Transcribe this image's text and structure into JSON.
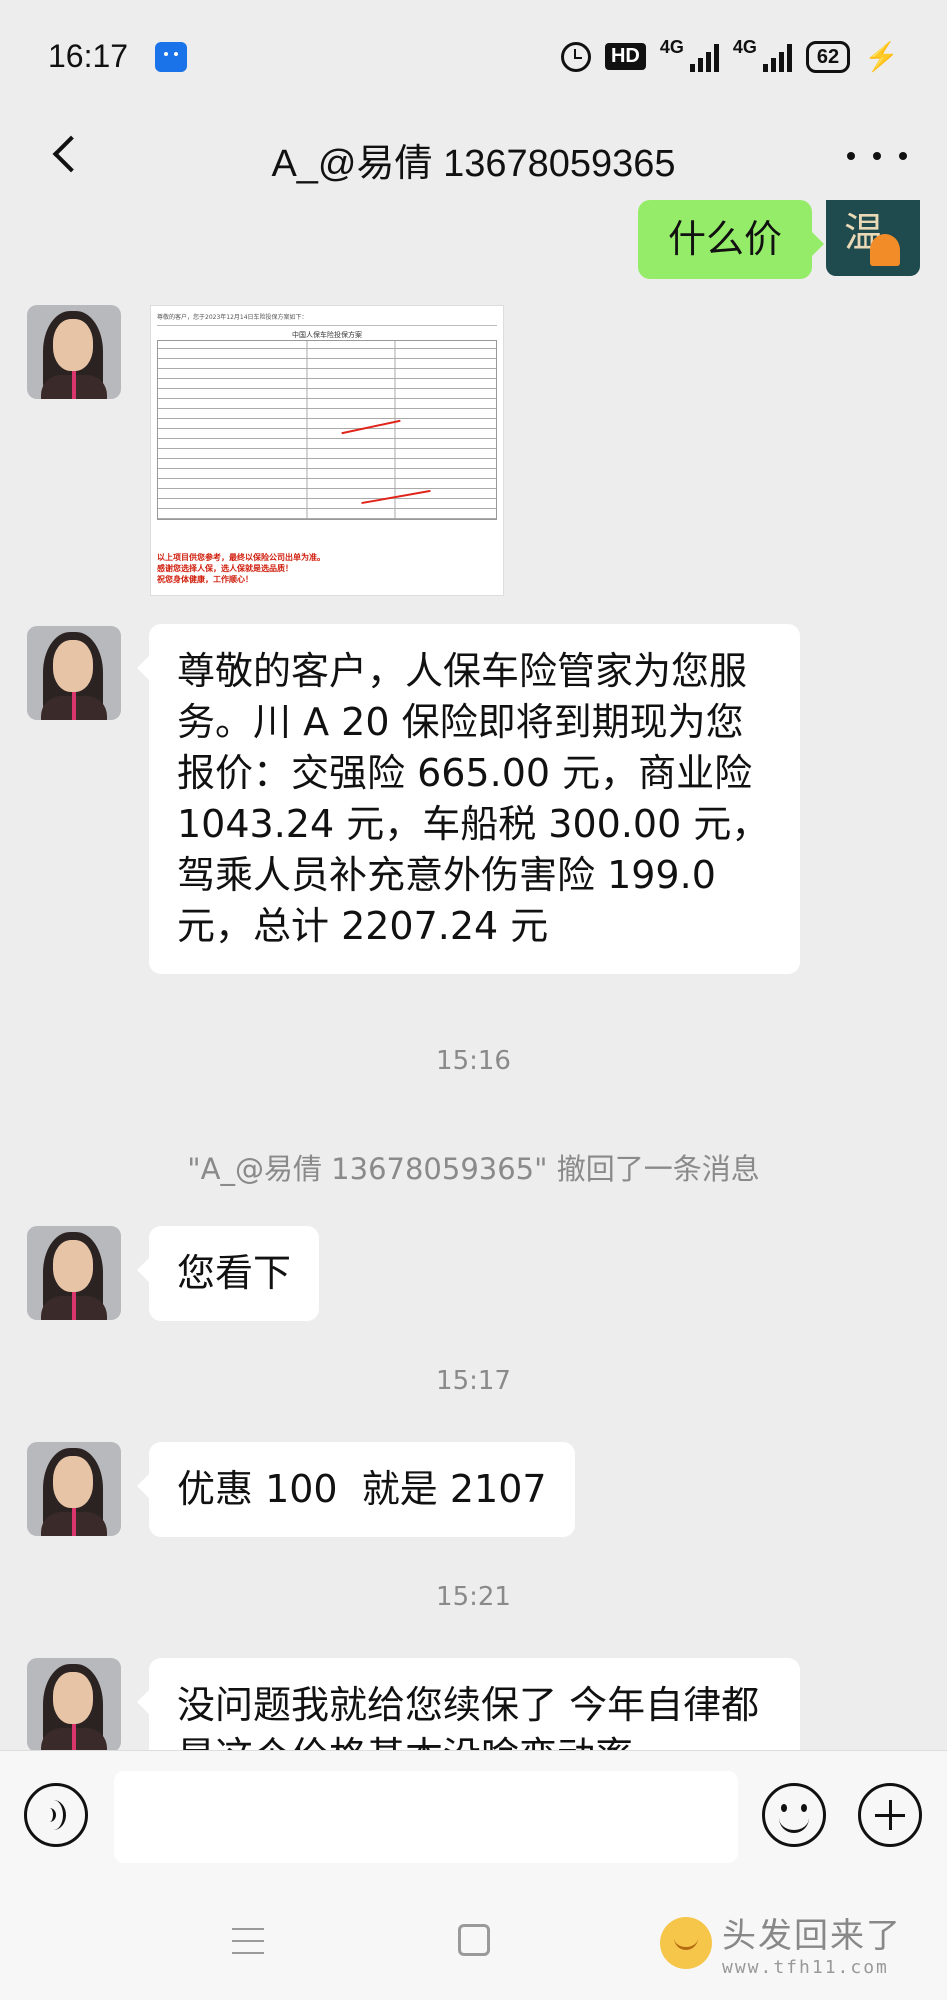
{
  "status_bar": {
    "time": "16:17",
    "hd_label": "HD",
    "net1": "4G",
    "net2": "4G",
    "battery": "62"
  },
  "nav": {
    "title": "A_@易倩 13678059365",
    "more": "more"
  },
  "messages": [
    {
      "side": "mine",
      "type": "text",
      "text": "什么价"
    },
    {
      "side": "theirs",
      "type": "image",
      "image": {
        "header": "尊敬的客户，您于2023年12月14日车险投保方案如下：",
        "title": "中国人保车险投保方案",
        "note_lines": [
          "以上项目供您参考，最终以保险公司出单为准。",
          "感谢您选择人保，选人保就是选品质！",
          "祝您身体健康，工作顺心！"
        ]
      }
    },
    {
      "side": "theirs",
      "type": "text",
      "text": "尊敬的客户，人保车险管家为您服务。川 A 20 保险即将到期现为您报价：交强险 665.00 元，商业险 1043.24 元，车船税 300.00 元，驾乘人员补充意外伤害险 199.0 元，总计 2207.24 元"
    },
    {
      "type": "time",
      "text": "15:16"
    },
    {
      "type": "system",
      "text": "\"A_@易倩 13678059365\" 撤回了一条消息"
    },
    {
      "side": "theirs",
      "type": "text",
      "text": "您看下"
    },
    {
      "type": "time",
      "text": "15:17"
    },
    {
      "side": "theirs",
      "type": "text",
      "text": "优惠 100  就是 2107"
    },
    {
      "type": "time",
      "text": "15:21"
    },
    {
      "side": "theirs",
      "type": "text",
      "text": "没问题我就给您续保了  今年自律都是这个价格基本没啥变动率"
    }
  ],
  "my_avatar_char": "温",
  "watermark": {
    "main": "头发回来了",
    "url": "www.tfh11.com"
  },
  "icons": {
    "back": "back-arrow-icon",
    "more": "more-dots-icon",
    "voice": "voice-icon",
    "emoji": "emoji-icon",
    "plus": "plus-icon",
    "menu": "menu-icon",
    "home": "home-icon"
  },
  "colors": {
    "background": "#ededed",
    "my_bubble": "#95ec69",
    "their_bubble": "#ffffff",
    "meta_text": "#8a8a8a",
    "accent_red": "#e0251b"
  }
}
